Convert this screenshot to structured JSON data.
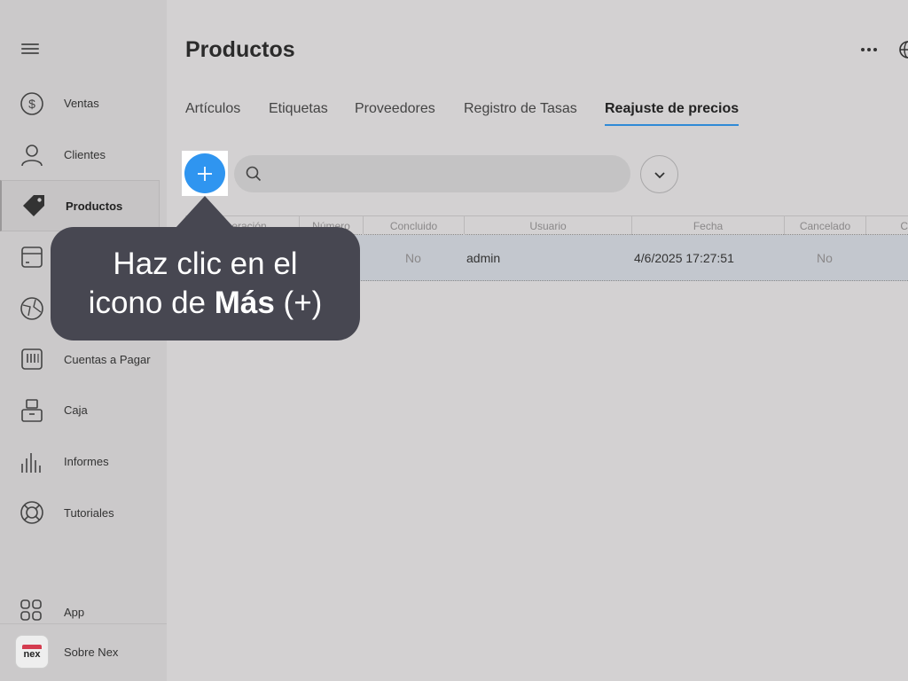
{
  "sidebar": {
    "menu_icon": "hamburger-icon",
    "items": [
      {
        "label": "Ventas",
        "icon": "dollar-circle-icon"
      },
      {
        "label": "Clientes",
        "icon": "person-icon"
      },
      {
        "label": "Productos",
        "icon": "tag-icon",
        "active": true
      },
      {
        "label": "",
        "icon": "box-icon"
      },
      {
        "label": "",
        "icon": "globe-chart-icon"
      },
      {
        "label": "Cuentas a Pagar",
        "icon": "invoice-icon"
      },
      {
        "label": "Caja",
        "icon": "cash-register-icon"
      },
      {
        "label": "Informes",
        "icon": "bar-chart-icon"
      },
      {
        "label": "Tutoriales",
        "icon": "lifebuoy-icon"
      }
    ],
    "app": {
      "label": "App",
      "icon": "grid-icon"
    },
    "about": {
      "label": "Sobre Nex",
      "logo_text": "nex"
    }
  },
  "header": {
    "title": "Productos",
    "more_icon": "more-dots-icon",
    "globe_icon": "globe-icon"
  },
  "tabs": [
    {
      "label": "Artículos"
    },
    {
      "label": "Etiquetas"
    },
    {
      "label": "Proveedores"
    },
    {
      "label": "Registro de Tasas"
    },
    {
      "label": "Reajuste de precios",
      "active": true
    }
  ],
  "toolbar": {
    "add_icon": "plus-icon",
    "search_placeholder": "",
    "search_value": "",
    "dropdown_icon": "chevron-down-icon"
  },
  "table": {
    "columns": [
      "Operación",
      "Número",
      "Concluido",
      "Usuario",
      "Fecha",
      "Cancelado",
      "C"
    ],
    "rows": [
      {
        "operacion": "",
        "numero": "",
        "concluido": "No",
        "usuario": "admin",
        "fecha": "4/6/2025 17:27:51",
        "cancelado": "No"
      }
    ]
  },
  "tooltip": {
    "line1": "Haz clic en el",
    "line2_pre": "icono de ",
    "line2_bold": "Más",
    "line2_post": " (+)"
  },
  "colors": {
    "accent": "#2f95f0",
    "tab_underline": "#2f8ad6",
    "tooltip_bg": "#474751",
    "selected_row": "#c3c7ce",
    "nex_brand": "#d43c4f"
  }
}
